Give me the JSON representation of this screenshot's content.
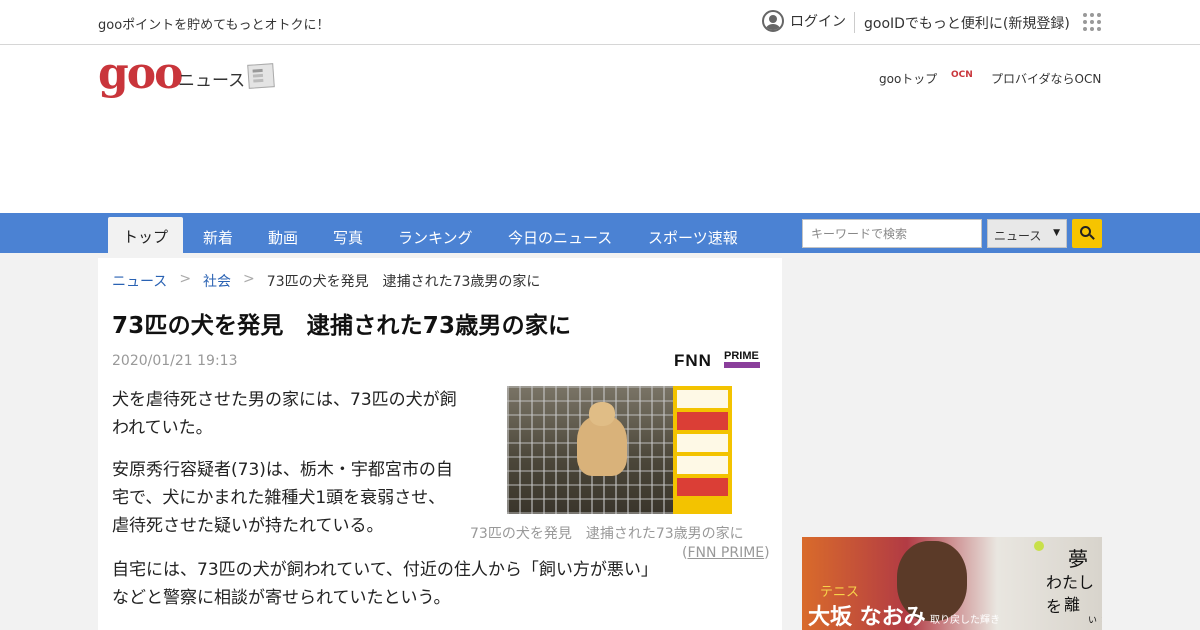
{
  "topbar": {
    "promo": "gooポイントを貯めてもっとオトクに！",
    "login": "ログイン",
    "register": "gooIDでもっと便利に(新規登録)"
  },
  "header": {
    "logo": "goo",
    "section": "ニュース",
    "goo_top": "gooトップ",
    "ocn_mark": "OCN",
    "ocn_text": "プロバイダならOCN"
  },
  "nav": {
    "items": [
      "トップ",
      "新着",
      "動画",
      "写真",
      "ランキング",
      "今日のニュース",
      "スポーツ速報"
    ],
    "active_index": 0
  },
  "search": {
    "placeholder": "キーワードで検索",
    "category": "ニュース"
  },
  "breadcrumb": {
    "items": [
      "ニュース",
      "社会",
      "73匹の犬を発見　逮捕された73歳男の家に"
    ],
    "separator": ">"
  },
  "article": {
    "headline": "73匹の犬を発見　逮捕された73歳男の家に",
    "date": "2020/01/21 19:13",
    "source_logo": {
      "letters": "FNN",
      "word": "PRIME"
    },
    "paragraphs": [
      "犬を虐待死させた男の家には、73匹の犬が飼われていた。",
      "安原秀行容疑者(73)は、栃木・宇都宮市の自宅で、犬にかまれた雑種犬1頭を衰弱させ、虐待死させた疑いが持たれている。",
      "自宅には、73匹の犬が飼われていて、付近の住人から「飼い方が悪い」などと警察に相談が寄せられていたという。"
    ],
    "caption": "73匹の犬を発見　逮捕された73歳男の家に",
    "caption_source": "FNN PRIME"
  },
  "side_ad": {
    "tag": "テニス",
    "name": "大坂 なおみ",
    "sub": "取り戻した輝き",
    "copy": [
      "夢",
      "わたしを",
      "離",
      "さない"
    ]
  },
  "colors": {
    "nav_bg": "#4b82d3",
    "logo_red": "#c9353b",
    "link_blue": "#2a62b3",
    "search_button": "#f6c400"
  }
}
